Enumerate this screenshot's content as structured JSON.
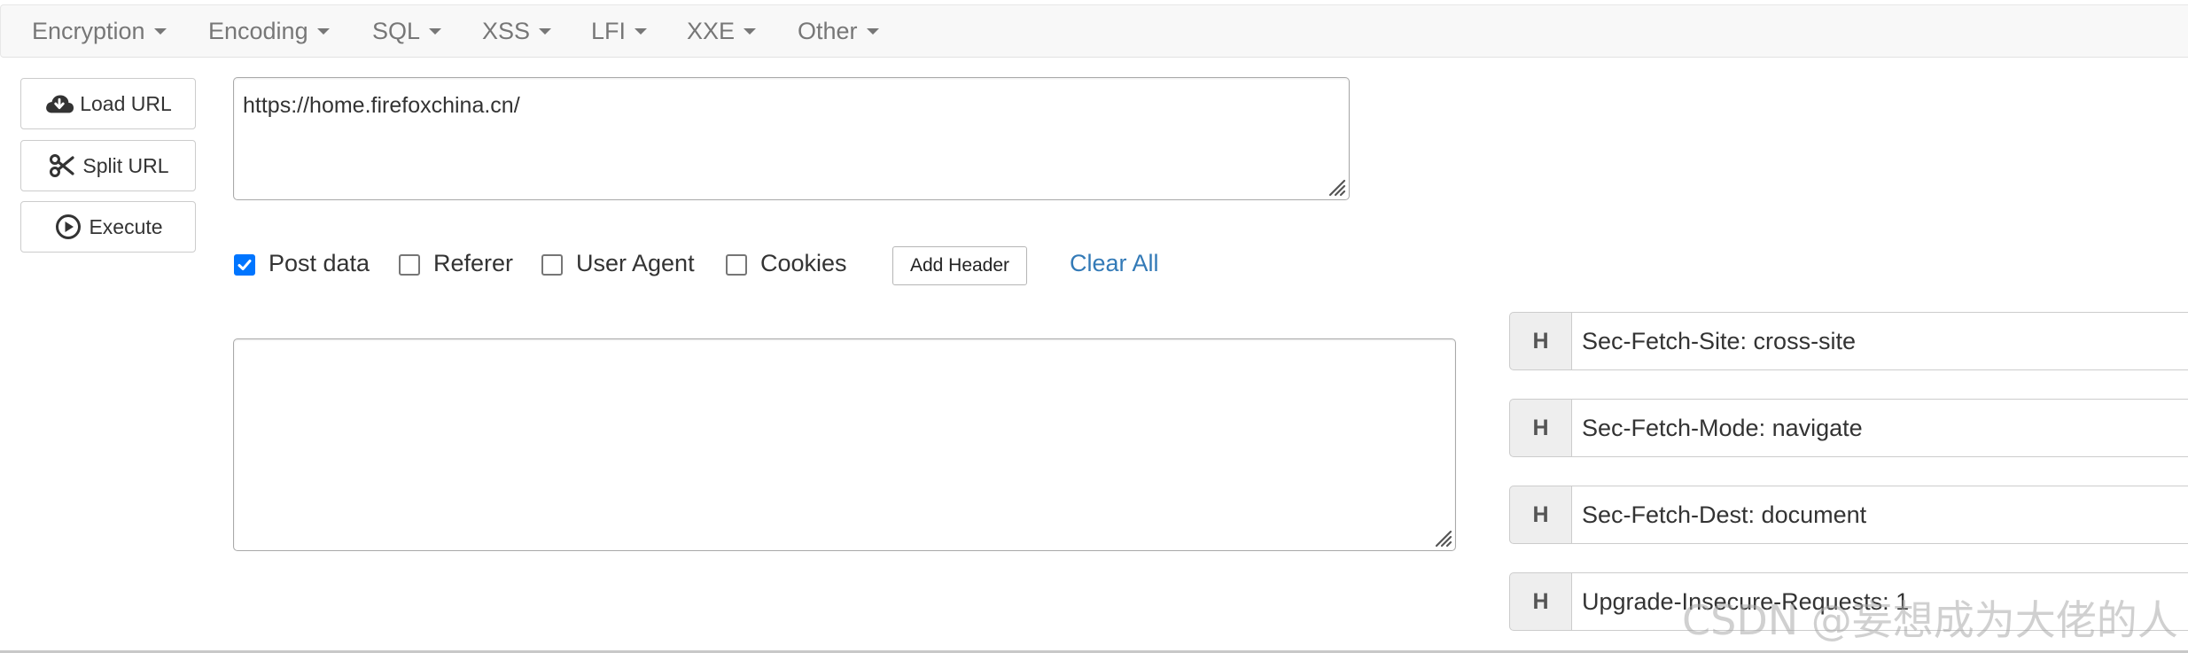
{
  "navbar": {
    "menus": [
      {
        "label": "Encryption"
      },
      {
        "label": "Encoding"
      },
      {
        "label": "SQL"
      },
      {
        "label": "XSS"
      },
      {
        "label": "LFI"
      },
      {
        "label": "XXE"
      },
      {
        "label": "Other"
      }
    ]
  },
  "actions": {
    "load_url": {
      "label": "Load URL",
      "icon": "cloud-download-icon"
    },
    "split_url": {
      "label": "Split URL",
      "icon": "scissors-icon"
    },
    "execute": {
      "label": "Execute",
      "icon": "play-circle-icon"
    }
  },
  "url_input": {
    "value": "https://home.firefoxchina.cn/"
  },
  "options": {
    "post_data": {
      "label": "Post data",
      "checked": true
    },
    "referer": {
      "label": "Referer",
      "checked": false
    },
    "user_agent": {
      "label": "User Agent",
      "checked": false
    },
    "cookies": {
      "label": "Cookies",
      "checked": false
    },
    "add_header_label": "Add Header",
    "clear_all_label": "Clear All"
  },
  "post_body": {
    "value": ""
  },
  "headers": [
    {
      "badge": "H",
      "value": "Sec-Fetch-Site: cross-site"
    },
    {
      "badge": "H",
      "value": "Sec-Fetch-Mode: navigate"
    },
    {
      "badge": "H",
      "value": "Sec-Fetch-Dest: document"
    },
    {
      "badge": "H",
      "value": "Upgrade-Insecure-Requests: 1"
    }
  ],
  "watermark": "CSDN @妄想成为大佬的人",
  "colors": {
    "accent_link": "#337ab7",
    "checkbox_checked": "#0075ff",
    "navbar_bg": "#f8f8f8"
  }
}
